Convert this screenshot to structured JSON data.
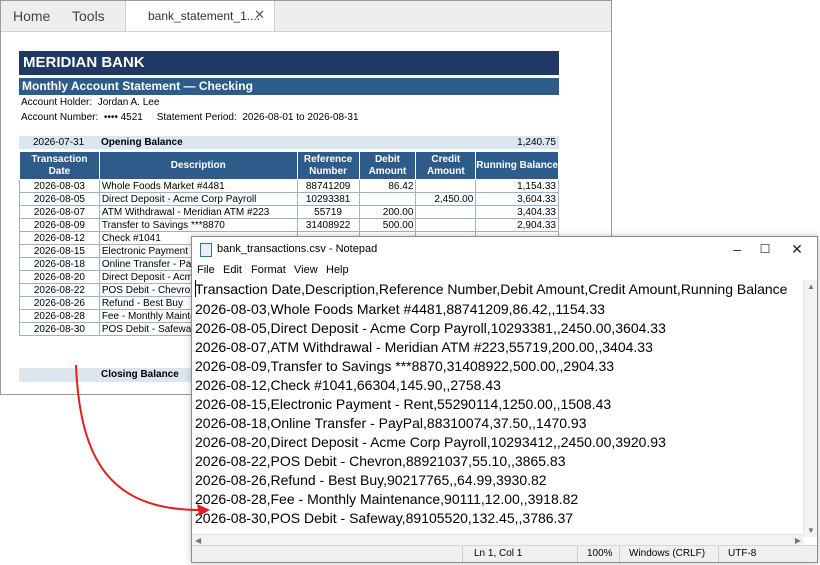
{
  "pdf_viewer": {
    "menu_tabs": [
      "Home",
      "Tools"
    ],
    "file_tab_label": "bank_statement_1....",
    "file_tab_close": "✕"
  },
  "statement": {
    "bank_name": "MERIDIAN BANK",
    "title": "Monthly Account Statement — Checking",
    "account_holder": "Account Holder:  Jordan A. Lee",
    "account_line": "Account Number:  •••• 4521     Statement Period:  2026-08-01 to 2026-08-31",
    "opening": {
      "date": "2026-07-31",
      "label": "Opening Balance",
      "value": "1,240.75"
    },
    "closing": {
      "label": "Closing Balance"
    },
    "headers": [
      "Transaction Date",
      "Description",
      "Reference Number",
      "Debit Amount",
      "Credit Amount",
      "Running Balance"
    ],
    "rows": [
      [
        "2026-08-03",
        "Whole Foods Market #4481",
        "88741209",
        "86.42",
        "",
        "1,154.33"
      ],
      [
        "2026-08-05",
        "Direct Deposit - Acme Corp Payroll",
        "10293381",
        "",
        "2,450.00",
        "3,604.33"
      ],
      [
        "2026-08-07",
        "ATM Withdrawal - Meridian ATM #223",
        "55719",
        "200.00",
        "",
        "3,404.33"
      ],
      [
        "2026-08-09",
        "Transfer to Savings ***8870",
        "31408922",
        "500.00",
        "",
        "2,904.33"
      ],
      [
        "2026-08-12",
        "Check #1041",
        "",
        "",
        "",
        ""
      ],
      [
        "2026-08-15",
        "Electronic Payment",
        "",
        "",
        "",
        ""
      ],
      [
        "2026-08-18",
        "Online Transfer - Pa",
        "",
        "",
        "",
        ""
      ],
      [
        "2026-08-20",
        "Direct Deposit - Acm",
        "",
        "",
        "",
        ""
      ],
      [
        "2026-08-22",
        "POS Debit - Chevron",
        "",
        "",
        "",
        ""
      ],
      [
        "2026-08-26",
        "Refund - Best Buy",
        "",
        "",
        "",
        ""
      ],
      [
        "2026-08-28",
        "Fee - Monthly Mainte",
        "",
        "",
        "",
        ""
      ],
      [
        "2026-08-30",
        "POS Debit - Safeway",
        "",
        "",
        "",
        ""
      ]
    ]
  },
  "notepad": {
    "title": "bank_transactions.csv - Notepad",
    "menu": [
      "File",
      "Edit",
      "Format",
      "View",
      "Help"
    ],
    "lines": [
      "Transaction Date,Description,Reference Number,Debit Amount,Credit Amount,Running Balance",
      "2026-08-03,Whole Foods Market #4481,88741209,86.42,,1154.33",
      "2026-08-05,Direct Deposit - Acme Corp Payroll,10293381,,2450.00,3604.33",
      "2026-08-07,ATM Withdrawal - Meridian ATM #223,55719,200.00,,3404.33",
      "2026-08-09,Transfer to Savings ***8870,31408922,500.00,,2904.33",
      "2026-08-12,Check #1041,66304,145.90,,2758.43",
      "2026-08-15,Electronic Payment - Rent,55290114,1250.00,,1508.43",
      "2026-08-18,Online Transfer - PayPal,88310074,37.50,,1470.93",
      "2026-08-20,Direct Deposit - Acme Corp Payroll,10293412,,2450.00,3920.93",
      "2026-08-22,POS Debit - Chevron,88921037,55.10,,3865.83",
      "2026-08-26,Refund - Best Buy,90217765,,64.99,3930.82",
      "2026-08-28,Fee - Monthly Maintenance,90111,12.00,,3918.82",
      "2026-08-30,POS Debit - Safeway,89105520,132.45,,3786.37"
    ],
    "status": {
      "position": "Ln 1, Col 1",
      "zoom": "100%",
      "line_ending": "Windows (CRLF)",
      "encoding": "UTF-8"
    }
  },
  "colors": {
    "bank_header": "#1f3864",
    "table_header": "#2e5c8a",
    "band": "#dce6f1",
    "arrow": "#e02020"
  }
}
